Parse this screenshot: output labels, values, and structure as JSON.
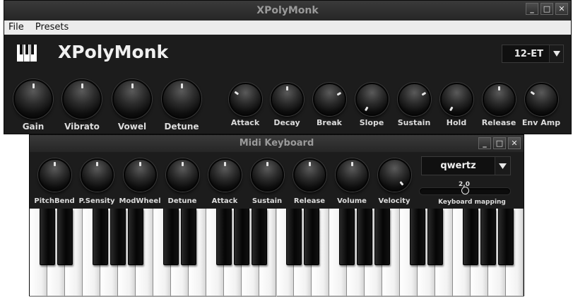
{
  "main_window": {
    "title": "XPolyMonk",
    "buttons": [
      "_",
      "□",
      "✕"
    ],
    "menu": [
      "File",
      "Presets"
    ],
    "app_title": "XPolyMonk",
    "tuning": {
      "value": "12-ET"
    },
    "knobs_large": [
      {
        "label": "Gain",
        "rotation": 0
      },
      {
        "label": "Vibrato",
        "rotation": 0
      },
      {
        "label": "Vowel",
        "rotation": 0
      },
      {
        "label": "Detune",
        "rotation": 0
      }
    ],
    "knobs_envelope": [
      {
        "label": "Attack",
        "rotation": -55
      },
      {
        "label": "Decay",
        "rotation": 0
      },
      {
        "label": "Break",
        "rotation": 60
      },
      {
        "label": "Slope",
        "rotation": -150
      },
      {
        "label": "Sustain",
        "rotation": 60
      },
      {
        "label": "Hold",
        "rotation": -150
      },
      {
        "label": "Release",
        "rotation": 0
      },
      {
        "label": "Env Amp",
        "rotation": -55
      }
    ]
  },
  "midi_window": {
    "title": "Midi Keyboard",
    "buttons": [
      "_",
      "□",
      "✕"
    ],
    "knobs": [
      {
        "label": "PitchBend",
        "rotation": 0
      },
      {
        "label": "P.Sensity",
        "rotation": 0
      },
      {
        "label": "ModWheel",
        "rotation": 0
      },
      {
        "label": "Detune",
        "rotation": 0
      },
      {
        "label": "Attack",
        "rotation": 0
      },
      {
        "label": "Sustain",
        "rotation": 0
      },
      {
        "label": "Release",
        "rotation": 0
      },
      {
        "label": "Volume",
        "rotation": 0
      },
      {
        "label": "Velocity",
        "rotation": 140
      }
    ],
    "layout": {
      "value": "qwertz"
    },
    "keyboard_mapping": {
      "label": "Keyboard mapping",
      "value": "2,0",
      "fraction": 0.5
    },
    "keyboard": {
      "white_keys": 28,
      "black_keys": 20
    }
  }
}
